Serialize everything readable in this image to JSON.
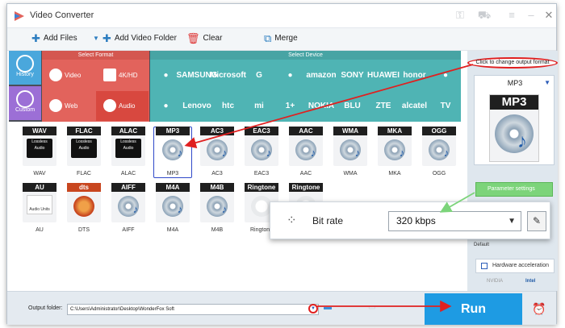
{
  "window": {
    "title": "Video Converter"
  },
  "titlebar_icons": [
    "key-icon",
    "cart-icon",
    "menu-icon",
    "minimize-icon",
    "close-icon"
  ],
  "toolbar": {
    "add_files": "Add Files",
    "add_video_folder": "Add Video Folder",
    "clear": "Clear",
    "merge": "Merge"
  },
  "side": {
    "history": "History",
    "custom": "Custom"
  },
  "format_panel": {
    "header": "Select Format",
    "buttons": [
      {
        "label": "Video"
      },
      {
        "label": "4K/HD"
      },
      {
        "label": "Web"
      },
      {
        "label": "Audio"
      }
    ]
  },
  "device_panel": {
    "header": "Select Device",
    "devices": [
      {
        "label": "",
        "name": "apple-icon"
      },
      {
        "label": "SAMSUNG"
      },
      {
        "label": "Microsoft"
      },
      {
        "label": "G",
        "name": "google-icon"
      },
      {
        "label": "",
        "name": "lg-icon"
      },
      {
        "label": "amazon"
      },
      {
        "label": "SONY"
      },
      {
        "label": "HUAWEI"
      },
      {
        "label": "honor"
      },
      {
        "label": "",
        "name": "asus-icon"
      },
      {
        "label": "",
        "name": "motorola-icon"
      },
      {
        "label": "Lenovo"
      },
      {
        "label": "htc"
      },
      {
        "label": "mi"
      },
      {
        "label": "1+",
        "name": "oneplus-icon"
      },
      {
        "label": "NOKIA"
      },
      {
        "label": "BLU"
      },
      {
        "label": "ZTE"
      },
      {
        "label": "alcatel"
      },
      {
        "label": "TV",
        "name": "tv-icon"
      }
    ]
  },
  "formats": [
    {
      "title": "WAV",
      "label": "WAV",
      "type": "lossless"
    },
    {
      "title": "FLAC",
      "label": "FLAC",
      "type": "lossless"
    },
    {
      "title": "ALAC",
      "label": "ALAC",
      "type": "lossless"
    },
    {
      "title": "MP3",
      "label": "MP3",
      "type": "disc",
      "selected": true
    },
    {
      "title": "AC3",
      "label": "AC3",
      "type": "disc"
    },
    {
      "title": "EAC3",
      "label": "EAC3",
      "type": "disc"
    },
    {
      "title": "AAC",
      "label": "AAC",
      "type": "disc"
    },
    {
      "title": "WMA",
      "label": "WMA",
      "type": "disc"
    },
    {
      "title": "MKA",
      "label": "MKA",
      "type": "disc"
    },
    {
      "title": "OGG",
      "label": "OGG",
      "type": "disc"
    },
    {
      "title": "AU",
      "label": "AU",
      "type": "au"
    },
    {
      "title": "dts",
      "label": "DTS",
      "type": "dts"
    },
    {
      "title": "AIFF",
      "label": "AIFF",
      "type": "disc"
    },
    {
      "title": "M4A",
      "label": "M4A",
      "type": "disc"
    },
    {
      "title": "M4B",
      "label": "M4B",
      "type": "disc"
    },
    {
      "title": "Ringtone",
      "label": "Ringtone",
      "type": "ringtone"
    },
    {
      "title": "Ringtone",
      "label": "",
      "type": "ringtone"
    }
  ],
  "lossless_text": "Lossless Audio",
  "au_text": "Audio Units",
  "right_panel": {
    "callout": "Click to change output format",
    "format": "MP3",
    "big_title": "MP3",
    "parameter_settings": "Parameter settings",
    "default": "Default",
    "hw_accel": "Hardware acceleration",
    "nvidia": "NVIDIA",
    "intel": "Intel"
  },
  "bitrate": {
    "label": "Bit rate",
    "value": "320 kbps"
  },
  "bottom": {
    "output_folder_label": "Output folder:",
    "output_path": "C:\\Users\\Administrator\\Desktop\\WonderFox Soft",
    "run": "Run"
  },
  "colors": {
    "format_red": "#e2635c",
    "device_teal": "#4fb4b4",
    "run_blue": "#1e9be3",
    "annotation_red": "#e02020",
    "annotation_green": "#7cd47a"
  }
}
